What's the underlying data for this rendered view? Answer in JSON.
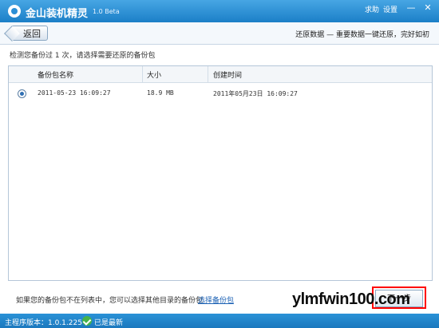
{
  "app": {
    "title": "金山装机精灵",
    "version": "1.0 Beta",
    "links": [
      "求助",
      "设置"
    ],
    "min_symbol": "—",
    "close_symbol": "✕"
  },
  "subheader": {
    "back_label": "返回",
    "breadcrumb": "还原数据 — 重要数据一键还原，完好如初"
  },
  "main": {
    "hint": "检测您备份过 1 次，请选择需要还原的备份包",
    "table": {
      "headers": [
        "备份包名称",
        "大小",
        "创建时间"
      ],
      "rows": [
        {
          "name": "2011-05-23 16:09:27",
          "size": "18.9 MB",
          "created": "2011年05月23日 16:09:27",
          "selected": true
        }
      ]
    },
    "footer_note": "如果您的备份包不在列表中，您可以选择其他目录的备份包",
    "choose_link": "选择备份包",
    "next_label": "下一步"
  },
  "status": {
    "version_text": "主程序版本：1.0.1.225",
    "update_text": "已是最新"
  },
  "watermark": "ylmfwin100.com",
  "colors": {
    "accent": "#1f8bd1",
    "link": "#1b61b4",
    "highlight": "#ff0000",
    "ok": "#45b34a"
  }
}
